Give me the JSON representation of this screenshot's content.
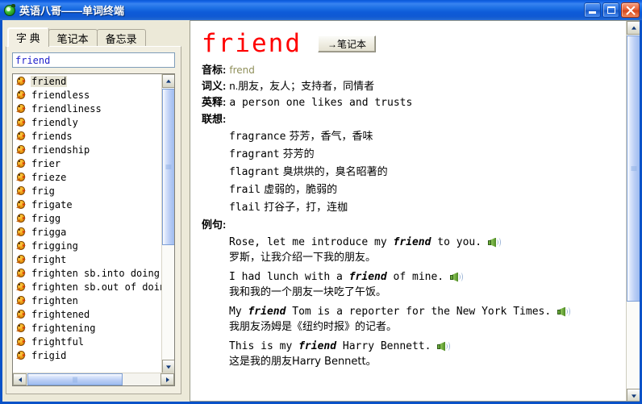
{
  "window": {
    "title": "英语八哥——单词终端",
    "icon": "app-parrot-icon",
    "buttons": {
      "minimize": "minimize-button",
      "maximize": "maximize-button",
      "close": "close-button"
    }
  },
  "left_panel": {
    "tabs": [
      {
        "label": "字  典",
        "active": true
      },
      {
        "label": "笔记本",
        "active": false
      },
      {
        "label": "备忘录",
        "active": false
      }
    ],
    "search": {
      "value": "friend",
      "placeholder": ""
    },
    "word_list": {
      "selected": "friend",
      "items": [
        "friend",
        "friendless",
        "friendliness",
        "friendly",
        "friends",
        "friendship",
        "frier",
        "frieze",
        "frig",
        "frigate",
        "frigg",
        "frigga",
        "frigging",
        "fright",
        "frighten sb.into doing s",
        "frighten sb.out of doing",
        "frighten",
        "frightened",
        "frightening",
        "frightful",
        "frigid"
      ]
    },
    "scrollbars": {
      "vertical_up": "▲",
      "vertical_down": "▼",
      "horizontal_left": "◀",
      "horizontal_right": "▶"
    }
  },
  "entry": {
    "headword": "friend",
    "note_button": "→笔记本",
    "fields": [
      {
        "label": "音标:",
        "value": "frend",
        "style": "phon"
      },
      {
        "label": "词义:",
        "value": "n.朋友，友人；支持者，同情者",
        "style": "cn"
      },
      {
        "label": "英释:",
        "value": "a person one likes and trusts",
        "style": "mono"
      }
    ],
    "association_label": "联想:",
    "associations": [
      {
        "en": "fragrance",
        "cn": "芬芳，香气，香味"
      },
      {
        "en": "fragrant",
        "cn": "芬芳的"
      },
      {
        "en": "flagrant",
        "cn": "臭烘烘的，臭名昭著的"
      },
      {
        "en": "frail",
        "cn": "虚弱的，脆弱的"
      },
      {
        "en": "flail",
        "cn": "打谷子，打，连枷"
      }
    ],
    "examples_label": "例句:",
    "examples": [
      {
        "en_pre": "Rose, let me introduce my ",
        "en_bold": "friend",
        "en_post": " to you.",
        "cn": "罗斯，让我介绍一下我的朋友。",
        "speaker": "speaker-icon"
      },
      {
        "en_pre": "I had lunch with a ",
        "en_bold": "friend",
        "en_post": " of mine.",
        "cn": "我和我的一个朋友一块吃了午饭。",
        "speaker": "speaker-icon"
      },
      {
        "en_pre": "My ",
        "en_bold": "friend",
        "en_post": " Tom is a reporter for the New York Times.",
        "cn": "我朋友汤姆是《纽约时报》的记者。",
        "speaker": "speaker-icon"
      },
      {
        "en_pre": "This is my ",
        "en_bold": "friend",
        "en_post": " Harry Bennett.",
        "cn": "这是我的朋友Harry Bennett。",
        "speaker": "speaker-icon"
      }
    ]
  },
  "colors": {
    "titlebar": "#0a58d8",
    "headword": "#ff0000",
    "search_text": "#2222cc",
    "panel_face": "#ece9d8",
    "phonetic": "#8f8f5a"
  }
}
